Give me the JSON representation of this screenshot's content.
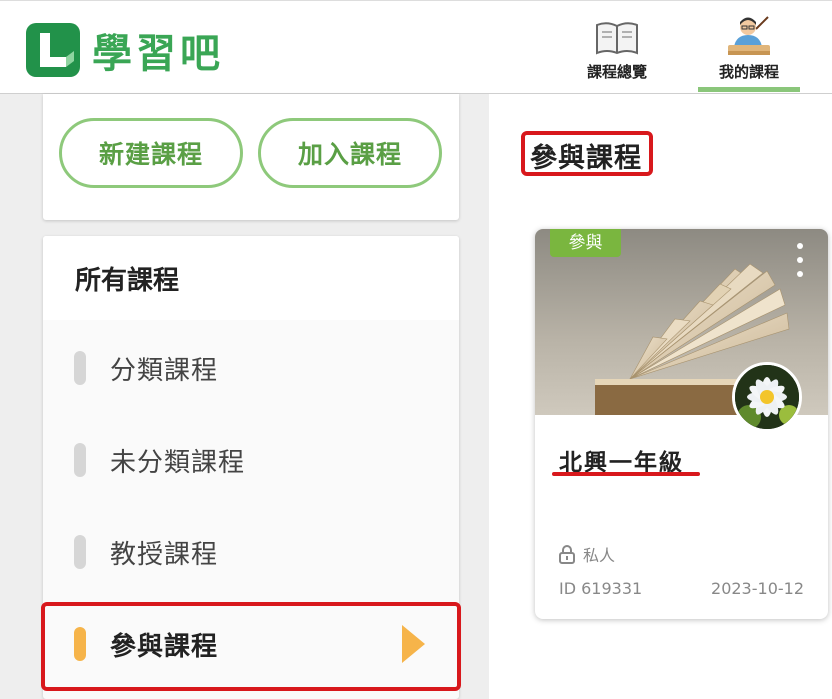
{
  "header": {
    "logo_text": "學習吧",
    "nav": [
      {
        "label": "課程總覽",
        "icon": "book-icon"
      },
      {
        "label": "我的課程",
        "icon": "teacher-icon",
        "active": true
      }
    ]
  },
  "sidebar": {
    "buttons": {
      "new_course": "新建課程",
      "join_course": "加入課程"
    },
    "list_title": "所有課程",
    "items": [
      {
        "label": "分類課程"
      },
      {
        "label": "未分類課程"
      },
      {
        "label": "教授課程"
      },
      {
        "label": "參與課程",
        "active": true
      }
    ]
  },
  "main": {
    "section_title": "參與課程",
    "course": {
      "tag": "參與",
      "name": "北興一年級",
      "privacy": "私人",
      "id_text": "ID 619331",
      "date": "2023-10-12"
    }
  },
  "colors": {
    "brand_green": "#3aa655",
    "pill_border": "#8ec97b",
    "active_orange": "#f6b44a",
    "tag_green": "#7ab63f",
    "annotation_red": "#d8181c"
  }
}
